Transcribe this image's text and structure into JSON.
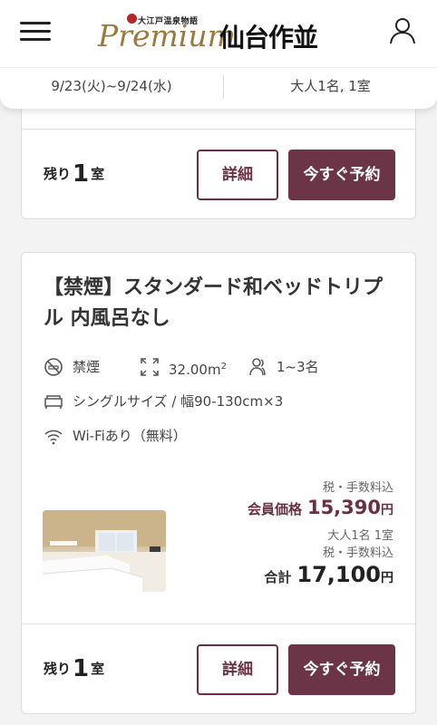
{
  "header": {
    "logo_small": "大江戸温泉物語",
    "logo_premium": "Premium",
    "logo_name": "仙台作並",
    "search": {
      "dates": "9/23(火)~9/24(水)",
      "guests": "大人1名, 1室"
    }
  },
  "top_card": {
    "remaining_prefix": "残り",
    "remaining_count": "1",
    "remaining_suffix": "室",
    "detail_label": "詳細",
    "book_label": "今すぐ予約"
  },
  "room": {
    "title": "【禁煙】スタンダード和ベッドトリプル 内風呂なし",
    "amenities": {
      "smoking": "禁煙",
      "area": "32.00m",
      "area_sup": "2",
      "capacity": "1~3名",
      "beds": "シングルサイズ / 幅90-130cm×3",
      "wifi": "Wi-Fiあり（無料）"
    },
    "member_tax_note": "税・手数料込",
    "member_price_label": "会員価格",
    "member_price": "15,390",
    "yen": "円",
    "guests_note": "大人1名 1室",
    "total_tax_note": "税・手数料込",
    "total_label": "合計",
    "total_price": "17,100",
    "remaining_prefix": "残り",
    "remaining_count": "1",
    "remaining_suffix": "室",
    "detail_label": "詳細",
    "book_label": "今すぐ予約"
  },
  "colors": {
    "accent": "#6b3447",
    "gold": "#9b7a3e"
  }
}
